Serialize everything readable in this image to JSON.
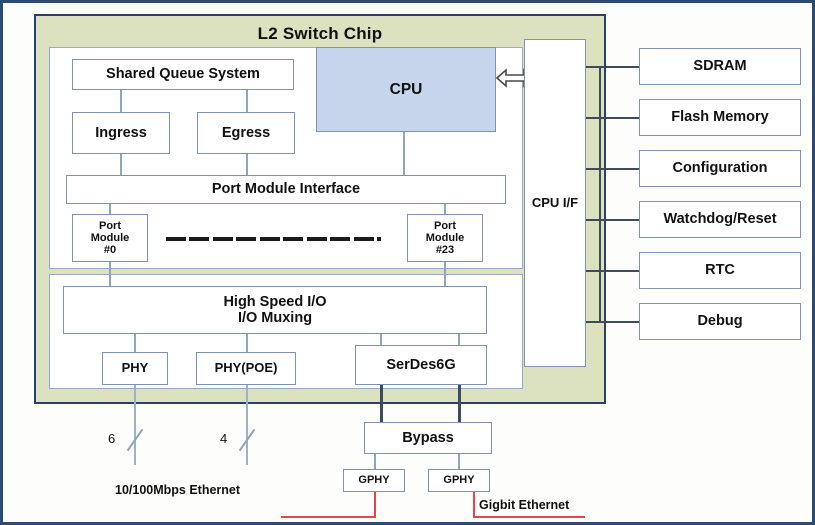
{
  "diagram": {
    "title": "L2 Switch Chip",
    "chip": {
      "label": "L2 Switch Chip",
      "fill_color": "#dce2c0",
      "border_color": "#28406a"
    },
    "switch_core": {
      "shared_queue": "Shared Queue System",
      "ingress": "Ingress",
      "egress": "Egress",
      "port_module_interface": "Port Module Interface",
      "port_module_first": "Port\nModule\n#0",
      "port_module_first_lines": [
        "Port",
        "Module",
        "#0"
      ],
      "port_module_last_lines": [
        "Port",
        "Module",
        "#23"
      ],
      "dash_count": 10
    },
    "cpu": {
      "label": "CPU",
      "fill_color": "#c6d4ec",
      "border_color": "#7e93b4"
    },
    "cpu_if": {
      "label": "CPU I/F"
    },
    "arrow": {
      "name": "bidirectional-arrow"
    },
    "io_block": {
      "high_speed_io_lines": [
        "High Speed I/O",
        "I/O Muxing"
      ],
      "phy": "PHY",
      "phy_poe": "PHY(POE)",
      "serdes": "SerDes6G"
    },
    "peripherals": [
      {
        "label": "SDRAM"
      },
      {
        "label": "Flash Memory"
      },
      {
        "label": "Configuration"
      },
      {
        "label": "Watchdog/Reset"
      },
      {
        "label": "RTC"
      },
      {
        "label": "Debug"
      }
    ],
    "external": {
      "bypass": "Bypass",
      "gphy_left": "GPHY",
      "gphy_right": "GPHY",
      "gigabit_ethernet_label": "Gigbit Ethernet",
      "fast_ethernet_label": "10/100Mbps Ethernet",
      "bus_width_phy": "6",
      "bus_width_phy_poe": "4",
      "red_line_color": "#e0474c"
    }
  }
}
